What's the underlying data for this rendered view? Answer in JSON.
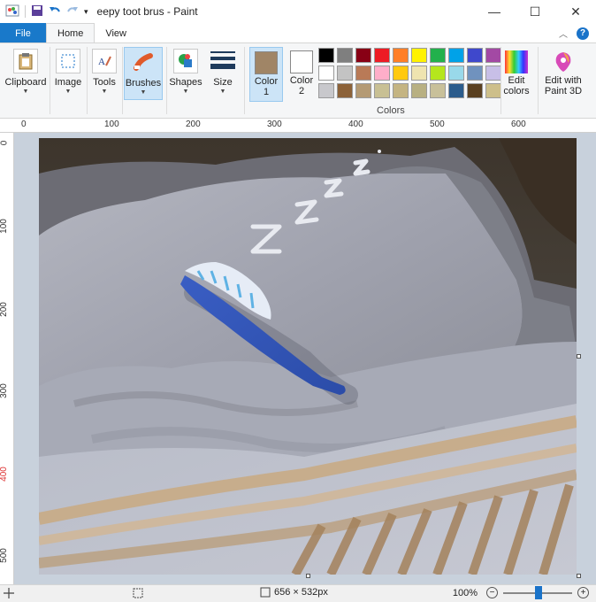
{
  "window": {
    "title": "eepy toot brus - Paint"
  },
  "tabs": {
    "file": "File",
    "home": "Home",
    "view": "View"
  },
  "ribbon": {
    "clipboard": "Clipboard",
    "image": "Image",
    "tools": "Tools",
    "brushes": "Brushes",
    "shapes": "Shapes",
    "size": "Size",
    "color1": {
      "line1": "Color",
      "line2": "1",
      "value": "#a08566"
    },
    "color2": {
      "line1": "Color",
      "line2": "2",
      "value": "#ffffff"
    },
    "colors_label": "Colors",
    "edit_colors": {
      "line1": "Edit",
      "line2": "colors"
    },
    "paint3d": {
      "line1": "Edit with",
      "line2": "Paint 3D"
    },
    "palette": [
      "#000000",
      "#7f7f7f",
      "#880015",
      "#ed1c24",
      "#ff7f27",
      "#fff200",
      "#22b14c",
      "#00a2e8",
      "#3f48cc",
      "#a349a4",
      "#ffffff",
      "#c3c3c3",
      "#b97a57",
      "#ffaec9",
      "#ffc90e",
      "#efe4b0",
      "#b5e61d",
      "#99d9ea",
      "#7092be",
      "#c8bfe7",
      "#c8c8cc",
      "#8c6239",
      "#b49a74",
      "#c8c094",
      "#c4b482",
      "#b8b082",
      "#c8c09a",
      "#2c5c8c",
      "#5a4020",
      "#cdbf8a"
    ]
  },
  "ruler": {
    "top": [
      "0",
      "100",
      "200",
      "300",
      "400",
      "500",
      "600"
    ],
    "left": [
      "0",
      "100",
      "200",
      "300",
      "400",
      "500"
    ]
  },
  "canvas": {
    "zzz": [
      "z",
      "z",
      "z",
      "z"
    ]
  },
  "status": {
    "size": "656 × 532px",
    "zoom": "100%"
  }
}
